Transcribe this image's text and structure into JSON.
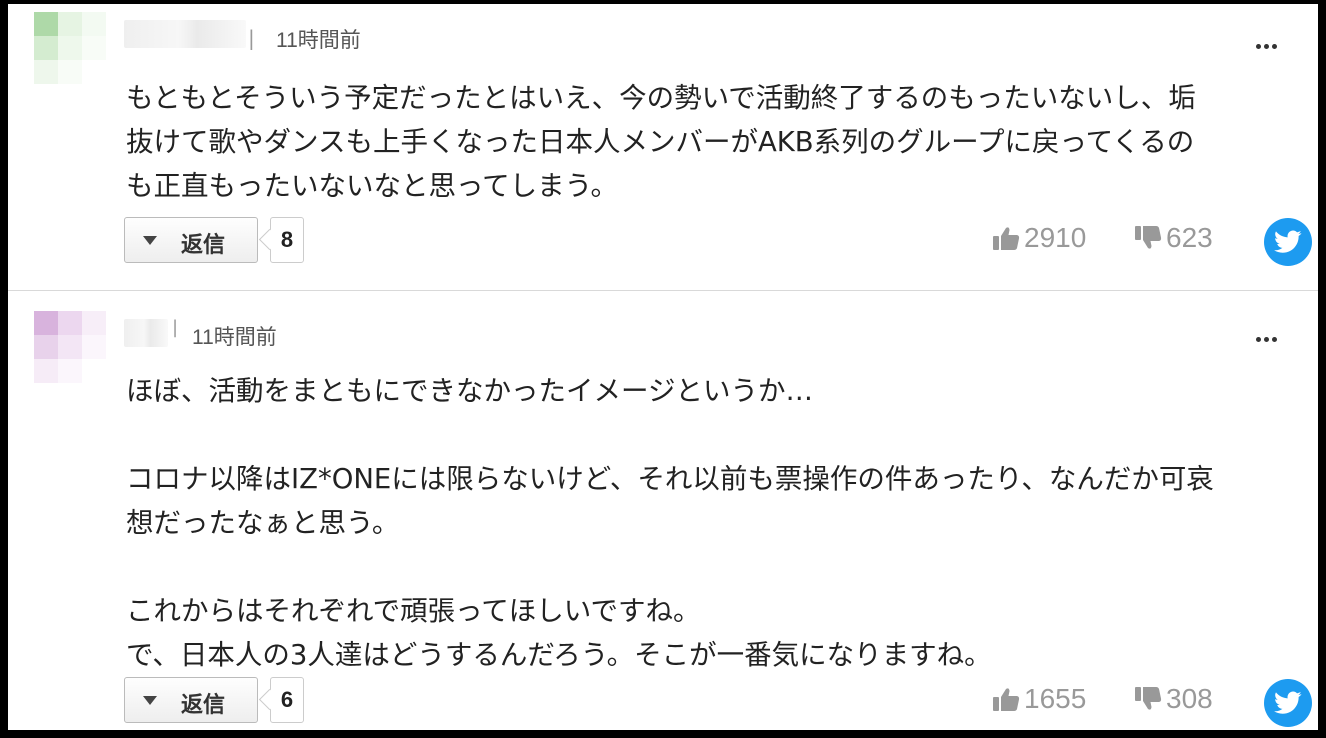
{
  "comments": [
    {
      "time": "11時間前",
      "separator": "|",
      "paragraphs": [
        "もともとそういう予定だったとはいえ、今の勢いで活動終了するのもったいないし、垢",
        "抜けて歌やダンスも上手くなった日本人メンバーがAKB系列のグループに戻ってくるの",
        "も正直もったいないなと思ってしまう。"
      ],
      "reply_label": "返信",
      "reply_count": "8",
      "likes": "2910",
      "dislikes": "623",
      "avatar_colors": [
        "#aed9a8",
        "#e6f4e3",
        "#f3faf2",
        "#d4ecd0",
        "#eef8ec",
        "#f8fcf7",
        "#eef7ec",
        "#f8fcf7",
        "#ffffff"
      ]
    },
    {
      "time": "11時間前",
      "separator": "|",
      "paragraphs": [
        "ほぼ、活動をまともにできなかったイメージというか…",
        "",
        "コロナ以降はIZ*ONEには限らないけど、それ以前も票操作の件あったり、なんだか可哀",
        "想だったなぁと思う。",
        "",
        "これからはそれぞれで頑張ってほしいですね。",
        "で、日本人の3人達はどうするんだろう。そこが一番気になりますね。"
      ],
      "reply_label": "返信",
      "reply_count": "6",
      "likes": "1655",
      "dislikes": "308",
      "avatar_colors": [
        "#d8b3dd",
        "#ecd7ef",
        "#f7eef8",
        "#e8d2eb",
        "#f3e6f5",
        "#fbf6fc",
        "#f6ecf7",
        "#fbf6fc",
        "#ffffff"
      ]
    }
  ],
  "colors": {
    "twitter": "#1d9bf0",
    "muted": "#999999",
    "text": "#222222"
  },
  "icons": [
    "more-icon",
    "thumbs-up-icon",
    "thumbs-down-icon",
    "twitter-icon",
    "triangle-down-icon"
  ]
}
